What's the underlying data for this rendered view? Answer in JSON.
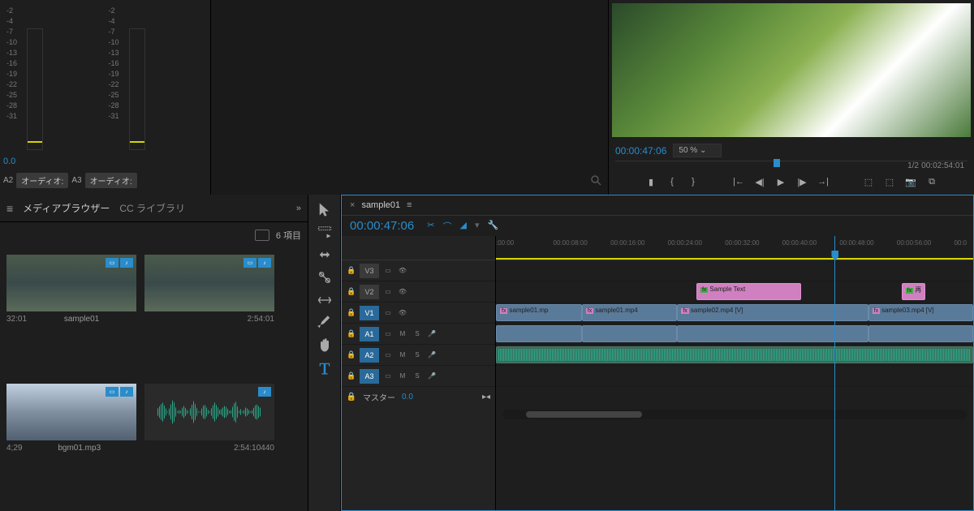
{
  "audio_panel": {
    "meter_scale": [
      "-2",
      "-4",
      "-7",
      "-10",
      "-13",
      "-16",
      "-19",
      "-22",
      "-25",
      "-28",
      "-31"
    ],
    "timecode": "0.0",
    "track_a2": "A2",
    "track_a3": "A3",
    "audio_label": "オーディオ:"
  },
  "preview": {
    "timecode": "00:00:47:06",
    "zoom": "50 %",
    "fraction": "1/2",
    "total_time": "00:02:54:01"
  },
  "browser": {
    "tab_media": "メディアブラウザー",
    "tab_cc": "CC ライブラリ",
    "item_count": "6 項目",
    "items": [
      {
        "name": "sample01",
        "dur_left": "32:01",
        "dur_right": "2:54:01",
        "thumb": "water"
      },
      {
        "name": "bgm01.mp3",
        "dur_left": "4;29",
        "dur_right": "2:54:10440",
        "thumb": "audio"
      }
    ]
  },
  "timeline": {
    "sequence_name": "sample01",
    "timecode": "00:00:47:06",
    "ruler_ticks": [
      ":00:00",
      "00:00:08:00",
      "00:00:16:00",
      "00:00:24:00",
      "00:00:32:00",
      "00:00:40:00",
      "00:00:48:00",
      "00:00:56:00",
      "00:0"
    ],
    "video_tracks": [
      {
        "name": "V3"
      },
      {
        "name": "V2"
      },
      {
        "name": "V1",
        "active": true
      }
    ],
    "audio_tracks": [
      {
        "name": "A1",
        "active": true
      },
      {
        "name": "A2",
        "active": true
      },
      {
        "name": "A3",
        "active": true
      }
    ],
    "master_label": "マスター",
    "master_value": "0.0",
    "clips": {
      "v2_text": "Sample Text",
      "v1_clip1": "sample01.mp",
      "v1_clip2": "sample01.mp4",
      "v1_clip3": "sample02.mp4 [V]",
      "v1_clip4": "sample03.mp4 [V]",
      "v2_text2": "再"
    },
    "track_toggles": {
      "m": "M",
      "s": "S"
    }
  }
}
